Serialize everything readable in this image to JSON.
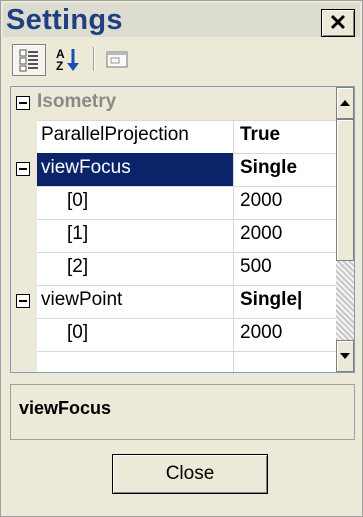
{
  "window": {
    "title": "Settings",
    "close_glyph": "✕",
    "icons": [
      "close-icon",
      "categorized-icon",
      "alphabetical-icon",
      "property-pages-icon",
      "collapse-icon",
      "scroll-up-icon",
      "scroll-down-icon"
    ]
  },
  "grid": {
    "category": "Isometry",
    "rows": [
      {
        "name": "ParallelProjection",
        "value": "True"
      },
      {
        "name": "viewFocus",
        "value": "Single"
      },
      {
        "name": "[0]",
        "value": "2000"
      },
      {
        "name": "[1]",
        "value": "2000"
      },
      {
        "name": "[2]",
        "value": "500"
      },
      {
        "name": "viewPoint",
        "value": "Single|"
      },
      {
        "name": "[0]",
        "value": "2000"
      }
    ],
    "selected": "viewFocus"
  },
  "description": {
    "title": "viewFocus"
  },
  "buttons": {
    "close_label": "Close"
  },
  "colors": {
    "selection": "#0a246a",
    "title_text": "#1f3f82"
  }
}
